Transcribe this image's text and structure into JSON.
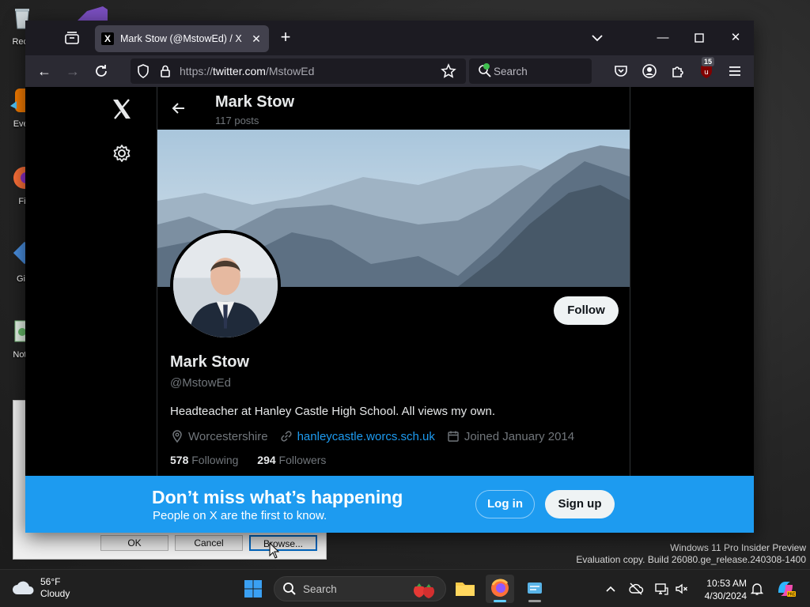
{
  "desktop": {
    "icons": [
      {
        "label": "Recy"
      },
      {
        "label": "Ever"
      },
      {
        "label": "Fi"
      },
      {
        "label": "Git"
      },
      {
        "label": "Note"
      }
    ],
    "dialog_buttons": {
      "ok": "OK",
      "cancel": "Cancel",
      "browse": "Browse..."
    },
    "watermark": {
      "line1": "Windows 11 Pro Insider Preview",
      "line2": "Evaluation copy. Build 26080.ge_release.240308-1400"
    }
  },
  "browser": {
    "tab": {
      "favicon": "X",
      "title": "Mark Stow (@MstowEd) / X"
    },
    "url": {
      "scheme": "https://",
      "host": "twitter.com",
      "path": "/MstowEd"
    },
    "search_placeholder": "Search",
    "extension_badge": "15"
  },
  "profile": {
    "header_name": "Mark Stow",
    "posts_count": "117 posts",
    "follow_label": "Follow",
    "name": "Mark Stow",
    "handle": "@MstowEd",
    "bio": "Headteacher at Hanley Castle High School. All views my own.",
    "location": "Worcestershire",
    "website": "hanleycastle.worcs.sch.uk",
    "joined": "Joined January 2014",
    "following_count": "578",
    "following_label": "Following",
    "followers_count": "294",
    "followers_label": "Followers"
  },
  "signup_banner": {
    "title": "Don’t miss what’s happening",
    "subtitle": "People on X are the first to know.",
    "login_label": "Log in",
    "signup_label": "Sign up"
  },
  "taskbar": {
    "weather": {
      "temp": "56°F",
      "condition": "Cloudy"
    },
    "search_placeholder": "Search",
    "time": "10:53 AM",
    "date": "4/30/2024"
  },
  "colors": {
    "accent": "#1d9bf0",
    "page_bg": "#000000",
    "browser_chrome": "#2b2a33"
  }
}
